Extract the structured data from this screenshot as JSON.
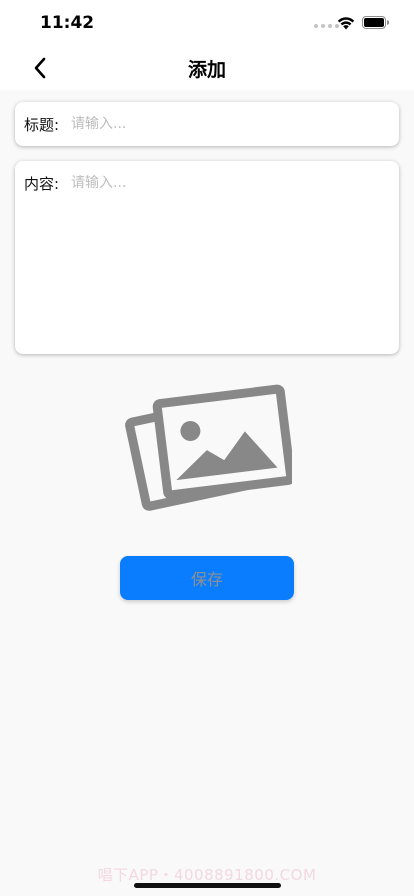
{
  "status_bar": {
    "time": "11:42"
  },
  "nav": {
    "title": "添加",
    "back_icon": "chevron-left-icon"
  },
  "form": {
    "title_label": "标题:",
    "title_placeholder": "请输入...",
    "title_value": "",
    "content_label": "内容:",
    "content_placeholder": "请输入...",
    "content_value": ""
  },
  "image_picker": {
    "icon": "images-icon"
  },
  "save_button": {
    "label": "保存"
  },
  "watermark": {
    "text": "唱下APP・4008891800.COM"
  },
  "colors": {
    "accent": "#0a7dff",
    "button_text": "#8f8f8f",
    "icon_gray": "#888888",
    "placeholder": "#bdbdbd",
    "background": "#f9f9f9"
  }
}
